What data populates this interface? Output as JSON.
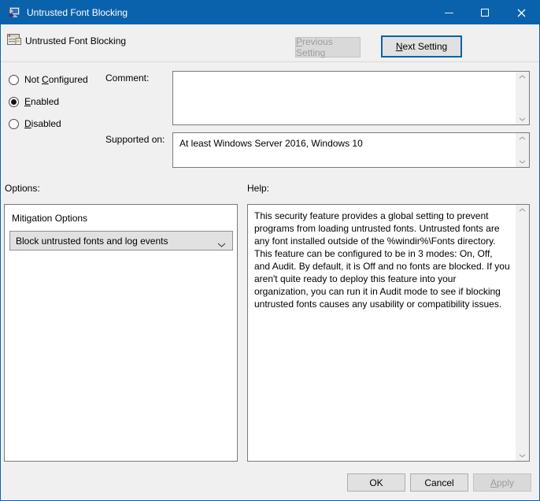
{
  "window": {
    "title": "Untrusted Font Blocking"
  },
  "colors": {
    "titlebar": "#0a62ac",
    "accent_border": "#0a62ac",
    "dialog_background": "#f0f0f0"
  },
  "header": {
    "setting_name": "Untrusted Font Blocking",
    "previous_setting": {
      "pre": "",
      "key": "P",
      "post": "revious Setting"
    },
    "next_setting": {
      "pre": "",
      "key": "N",
      "post": "ext Setting"
    }
  },
  "radios": {
    "not_configured": {
      "pre": "Not ",
      "key": "C",
      "post": "onfigured",
      "selected": false
    },
    "enabled": {
      "pre": "",
      "key": "E",
      "post": "nabled",
      "selected": true
    },
    "disabled": {
      "pre": "",
      "key": "D",
      "post": "isabled",
      "selected": false
    }
  },
  "comment": {
    "label": "Comment:",
    "value": ""
  },
  "supported_on": {
    "label": "Supported on:",
    "value": "At least Windows Server 2016, Windows 10"
  },
  "options_panel": {
    "label": "Options:",
    "mitigation_label": "Mitigation Options",
    "dropdown_value": "Block untrusted fonts and log events"
  },
  "help_panel": {
    "label": "Help:",
    "text": "This security feature provides a global setting to prevent programs from loading untrusted fonts. Untrusted fonts are any font installed outside of the %windir%\\Fonts directory. This feature can be configured to be in 3 modes: On, Off, and Audit. By default, it is Off and no fonts are blocked. If you aren't quite ready to deploy this feature into your organization, you can run it in Audit mode to see if blocking untrusted fonts causes any usability or compatibility issues."
  },
  "footer": {
    "ok": "OK",
    "cancel": "Cancel",
    "apply": {
      "pre": "",
      "key": "A",
      "post": "pply"
    }
  }
}
